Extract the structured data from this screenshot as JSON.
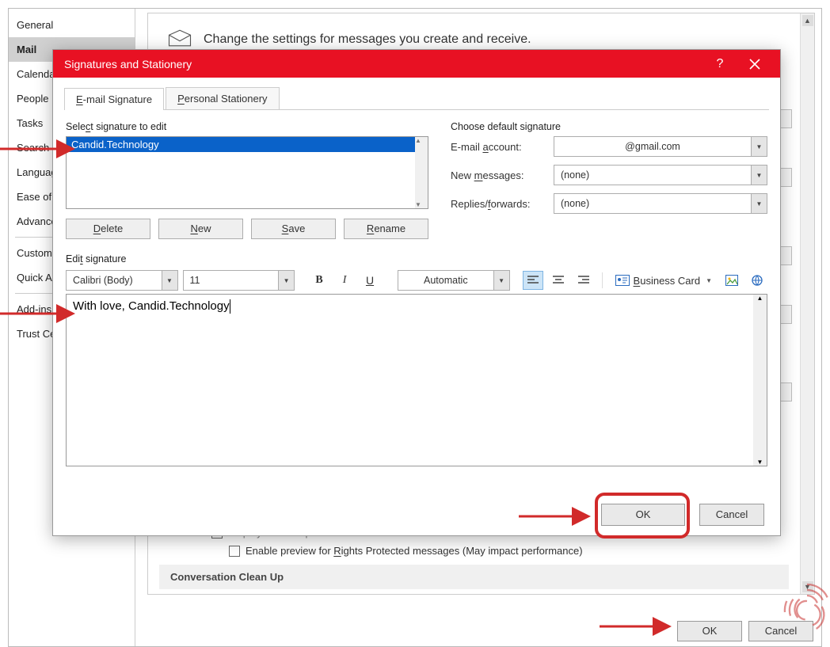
{
  "options": {
    "nav": [
      "General",
      "Mail",
      "Calendar",
      "People",
      "Tasks",
      "Search",
      "Language",
      "Ease of Access",
      "Advanced",
      "Customize Ribbon",
      "Quick Access Toolbar",
      "Add-ins",
      "Trust Center"
    ],
    "nav_selected": 1,
    "header_text": "Change the settings for messages you create and receive.",
    "desktop_alert": "Display a Desktop Alert",
    "rights_preview": "Enable preview for Rights Protected messages (May impact performance)",
    "section_cleanup": "Conversation Clean Up",
    "ok": "OK",
    "cancel": "Cancel"
  },
  "dialog": {
    "title": "Signatures and Stationery",
    "tabs": {
      "email": "E-mail Signature",
      "personal": "Personal Stationery"
    },
    "select_label": "Select signature to edit",
    "sig_item": "Candid.Technology",
    "btn_delete": "Delete",
    "btn_new": "New",
    "btn_save": "Save",
    "btn_rename": "Rename",
    "default_label": "Choose default signature",
    "email_account_label": "E-mail account:",
    "email_account_value": "@gmail.com",
    "new_msg_label": "New messages:",
    "new_msg_value": "(none)",
    "replies_label": "Replies/forwards:",
    "replies_value": "(none)",
    "edit_label": "Edit signature",
    "font_name": "Calibri (Body)",
    "font_size": "11",
    "color_auto": "Automatic",
    "business_card": "Business Card",
    "editor_text": "With love, Candid.Technology",
    "ok": "OK",
    "cancel": "Cancel"
  }
}
